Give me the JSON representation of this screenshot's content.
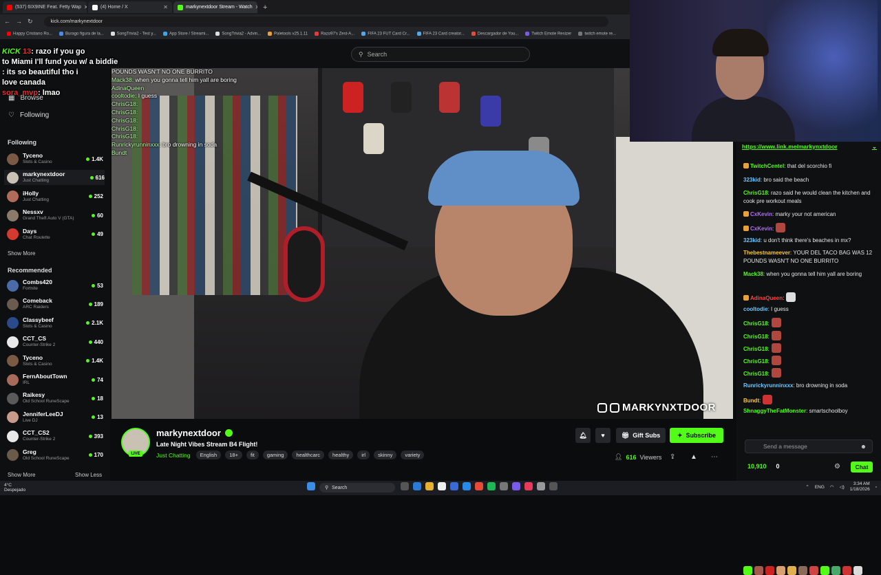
{
  "browser": {
    "tabs": [
      {
        "label": "(537) 6IX9INE Feat. Fetty Wap",
        "color": "#ff0000"
      },
      {
        "label": "(4) Home / X",
        "color": "#ffffff"
      },
      {
        "label": "markynextdoor Stream - Watch",
        "color": "#53fc18",
        "active": true
      }
    ],
    "new_tab": "+",
    "url": "kick.com/markynextdoor",
    "bookmarks": [
      "Happy Cristiano Ro...",
      "Burago figura de la...",
      "SongTrivia2 - Test y...",
      "App Store / Streami...",
      "SongTrivia2 - Advin...",
      "Paletools v25.1.11",
      "Razo97's Zest-A...",
      "FIFA 23 FUT Card Cr...",
      "FIFA 23 Card creator...",
      "Descargador de You...",
      "Twitch Emote Resizer",
      "twitch emote re..."
    ]
  },
  "search": {
    "placeholder": "Search"
  },
  "overlay_top": {
    "line1_user": "13",
    "line1_text": ": razo if you go",
    "line2": "to Miami I'll fund you w/ a biddie",
    "line3_user": "",
    "line3_text": ": its so beautiful tho i",
    "line4": "love canada",
    "line5_user": "sora_mvp",
    "line5_text": ": lmao",
    "kick_logo": "KICK"
  },
  "sidebar": {
    "browse": "Browse",
    "following_nav": "Following",
    "following_title": "Following",
    "following": [
      {
        "name": "Tyceno",
        "category": "Slots & Casino",
        "viewers": "1.4K",
        "color": "#7a5a44"
      },
      {
        "name": "markynextdoor",
        "category": "Just Chatting",
        "viewers": "616",
        "color": "#c9c2b4",
        "active": true
      },
      {
        "name": "iHolly",
        "category": "Just Chatting",
        "viewers": "252",
        "color": "#b06c5a"
      },
      {
        "name": "Nessxv",
        "category": "Grand Theft Auto V (GTA)",
        "viewers": "60",
        "color": "#8a7a6a"
      },
      {
        "name": "Days",
        "category": "Chat Roulette",
        "viewers": "49",
        "color": "#d43a2f"
      }
    ],
    "show_more_1": "Show More",
    "recommended_title": "Recommended",
    "recommended": [
      {
        "name": "Combs420",
        "category": "Fortnite",
        "viewers": "53",
        "color": "#4a6aa8"
      },
      {
        "name": "Comeback",
        "category": "ARC Raiders",
        "viewers": "189",
        "color": "#6a5a50"
      },
      {
        "name": "Classybeef",
        "category": "Slots & Casino",
        "viewers": "2.1K",
        "color": "#2a4a8a"
      },
      {
        "name": "CCT_CS",
        "category": "Counter-Strike 2",
        "viewers": "440",
        "color": "#e8e8e8"
      },
      {
        "name": "Tyceno",
        "category": "Slots & Casino",
        "viewers": "1.4K",
        "color": "#7a5a44"
      },
      {
        "name": "FernAboutTown",
        "category": "IRL",
        "viewers": "74",
        "color": "#a86a5a"
      },
      {
        "name": "Raikesy",
        "category": "Old School RuneScape",
        "viewers": "18",
        "color": "#5a5a5a"
      },
      {
        "name": "JenniferLeeDJ",
        "category": "Live DJ",
        "viewers": "13",
        "color": "#c89a8a"
      },
      {
        "name": "CCT_CS2",
        "category": "Counter-Strike 2",
        "viewers": "393",
        "color": "#e8e8e8"
      },
      {
        "name": "Greg",
        "category": "Old School RuneScape",
        "viewers": "170",
        "color": "#6a5a4a"
      }
    ],
    "show_more_2": "Show More",
    "show_less": "Show Less"
  },
  "video_chat_overlay": [
    {
      "user": "",
      "text": "POUNDS WASN'T NO ONE BURRITO"
    },
    {
      "user": "Mack38:",
      "text": " when you gonna tell him yall are boring"
    },
    {
      "user": "AdinaQueen",
      "text": ""
    },
    {
      "user": "cooltodie",
      "text": ": I guess"
    },
    {
      "user": "ChrisG18:",
      "text": ""
    },
    {
      "user": "ChrisG18:",
      "text": ""
    },
    {
      "user": "ChrisG18:",
      "text": ""
    },
    {
      "user": "ChrisG18:",
      "text": ""
    },
    {
      "user": "ChrisG18:",
      "text": ""
    },
    {
      "user": "Runrickyrunninxxx",
      "text": ": bro drowning in soda"
    },
    {
      "user": "Bundt",
      "text": ""
    }
  ],
  "video_handle": "MARKYNXTDOOR",
  "stream": {
    "name": "markynextdoor",
    "title": "Late Night Vibes Stream B4 Flight!",
    "category": "Just Chatting",
    "tags": [
      "English",
      "18+",
      "fit",
      "gaming",
      "healthcarc",
      "healthy",
      "irl",
      "skinny",
      "variety"
    ],
    "live": "LIVE",
    "gift_subs": "Gift Subs",
    "subscribe": "Subscribe",
    "viewers": "616",
    "viewers_label": "Viewers"
  },
  "chat": {
    "pinned_link": "https://www.link.me/markynxtdoor",
    "messages": [
      {
        "user": "TwitchCentel",
        "text": ": that del scorchio fi",
        "color": "#53fc18"
      },
      {
        "user": "323kid",
        "text": ": bro said the beach",
        "color": "#6ec6ff"
      },
      {
        "user": "ChrisG18",
        "text": ": razo said he would clean the kitchen and cook pre workout meals",
        "color": "#53fc18"
      },
      {
        "user": "CxKevin",
        "text": ": marky your not american",
        "color": "#b36bff"
      },
      {
        "user": "CxKevin",
        "text": ":",
        "color": "#b36bff"
      },
      {
        "user": "323kid",
        "text": ": u don't think there's beaches in mx?",
        "color": "#6ec6ff"
      },
      {
        "user": "Thebestnameever",
        "text": ": YOUR DEL TACO BAG WAS 12 POUNDS WASN'T NO ONE BURRITO",
        "color": "#f5c542"
      },
      {
        "user": "Mack38",
        "text": ": when you gonna tell him yall are boring",
        "color": "#53fc18"
      },
      {
        "user": "AdinaQueen",
        "text": ":",
        "color": "#ff4444"
      },
      {
        "user": "cooltodie",
        "text": ": I guess",
        "color": "#6ec6ff"
      },
      {
        "user": "ChrisG18",
        "text": ":",
        "color": "#53fc18"
      },
      {
        "user": "ChrisG18",
        "text": ":",
        "color": "#53fc18"
      },
      {
        "user": "ChrisG18",
        "text": ":",
        "color": "#53fc18"
      },
      {
        "user": "ChrisG18",
        "text": ":",
        "color": "#53fc18"
      },
      {
        "user": "ChrisG18",
        "text": ":",
        "color": "#53fc18"
      },
      {
        "user": "Runrickyrunninxxx",
        "text": ": bro drowning in soda",
        "color": "#6ec6ff"
      },
      {
        "user": "Bundt",
        "text": ":",
        "color": "#f5c542"
      },
      {
        "user": "ShnaggyTheFatMonster",
        "text": ": smartschoolboy",
        "color": "#53fc18"
      }
    ],
    "input_placeholder": "Send a message",
    "points": "10,910",
    "count": "0",
    "send": "Chat"
  },
  "taskbar": {
    "weather_temp": "4°C",
    "weather_desc": "Despejado",
    "search": "Search",
    "lang": "ENG",
    "time": "3:34 AM",
    "date": "1/18/2026"
  }
}
